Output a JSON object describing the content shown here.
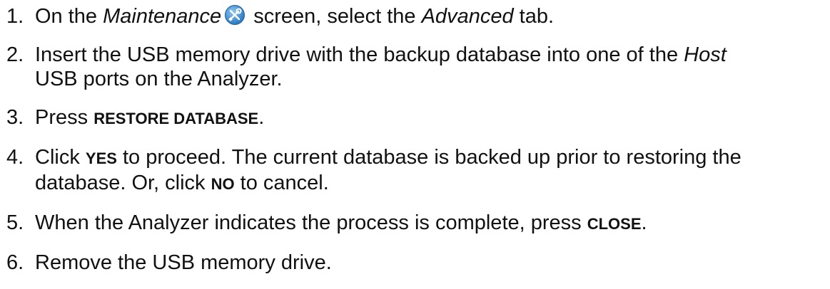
{
  "steps": [
    {
      "number": "1",
      "text_a": "On the ",
      "screen_name": "Maintenance",
      "text_b": " screen, select the ",
      "tab_name": "Advanced",
      "text_c": " tab.",
      "icon": "maintenance-tools-icon",
      "icon_color": "#3c8fd2"
    },
    {
      "number": "2",
      "text_a": "Insert the USB memory drive with the backup database into one of the ",
      "host": "Host",
      "line2": "USB ports on the Analyzer."
    },
    {
      "number": "3",
      "text_a": "Press ",
      "button": "Restore Database",
      "text_b": "."
    },
    {
      "number": "4",
      "text_a": "Click ",
      "yes": "Yes",
      "text_b": " to proceed. The current database is backed up prior to restoring the",
      "line2_a": "database. Or, click ",
      "no": "No",
      "line2_b": " to cancel."
    },
    {
      "number": "5",
      "text_a": "When the Analyzer indicates the process is complete, press ",
      "close": "Close",
      "text_b": "."
    },
    {
      "number": "6",
      "text_a": "Remove the USB memory drive."
    }
  ]
}
